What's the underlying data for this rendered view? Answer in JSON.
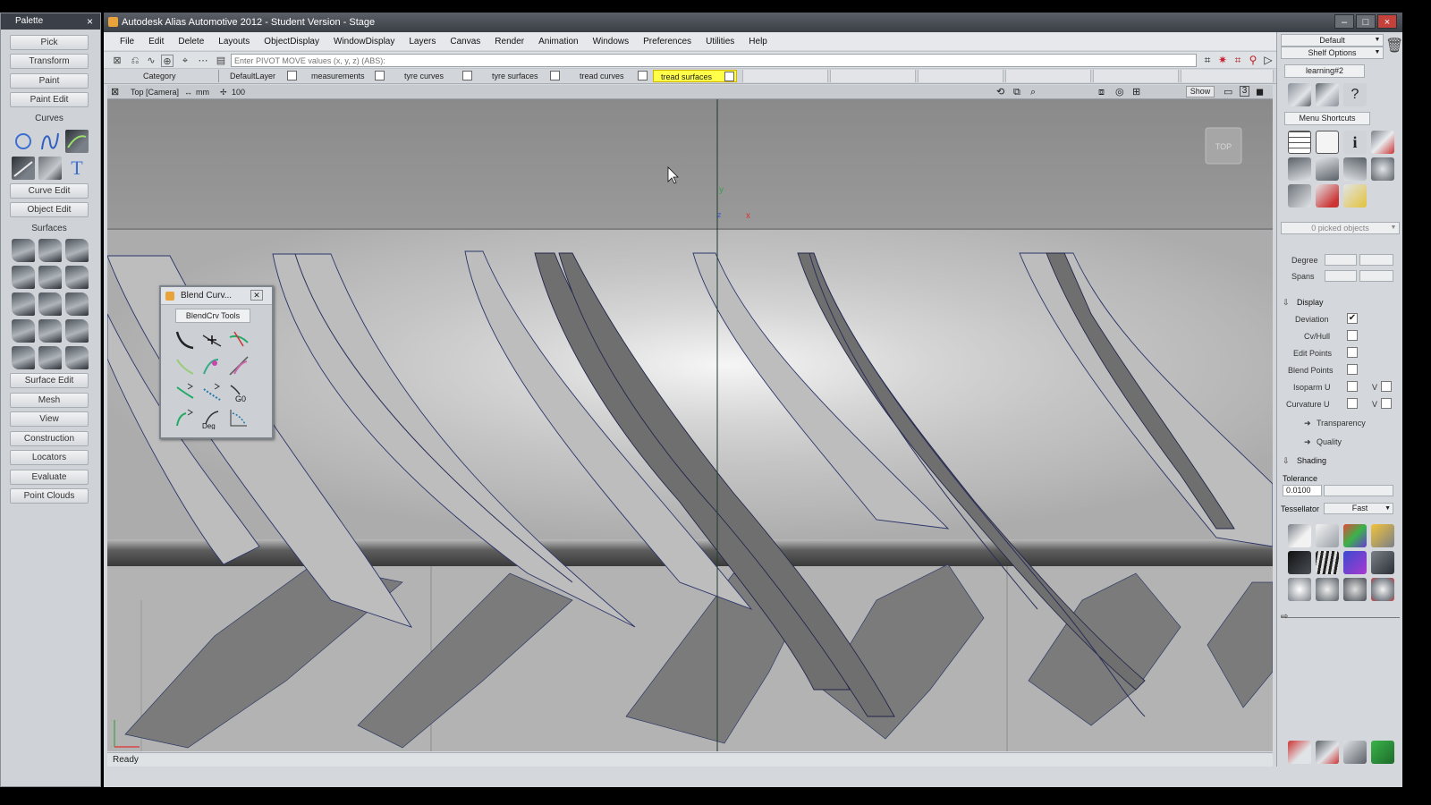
{
  "palette": {
    "title": "Palette",
    "buttons": {
      "pick": "Pick",
      "transform": "Transform",
      "paint": "Paint",
      "paint_edit": "Paint Edit",
      "curve_edit": "Curve Edit",
      "object_edit": "Object Edit",
      "surface_edit": "Surface Edit",
      "mesh": "Mesh",
      "view": "View",
      "construction": "Construction",
      "locators": "Locators",
      "evaluate": "Evaluate",
      "point_clouds": "Point Clouds"
    },
    "curves_header": "Curves",
    "surfaces_header": "Surfaces",
    "text_tool_glyph": "T"
  },
  "window": {
    "title": "Autodesk Alias Automotive 2012 - Student Version - Stage",
    "controls": [
      "–",
      "□",
      "×"
    ]
  },
  "menu": [
    "File",
    "Edit",
    "Delete",
    "Layouts",
    "ObjectDisplay",
    "WindowDisplay",
    "Layers",
    "Canvas",
    "Render",
    "Animation",
    "Windows",
    "Preferences",
    "Utilities",
    "Help"
  ],
  "prompt": {
    "placeholder": "Enter PIVOT MOVE values (x, y, z) (ABS):"
  },
  "layers": {
    "category": "Category",
    "items": [
      "DefaultLayer",
      "measurements",
      "tyre curves",
      "tyre surfaces",
      "tread curves",
      "tread surfaces"
    ],
    "active": "tread surfaces"
  },
  "viewport": {
    "camera": "Top [Camera]",
    "units": "mm",
    "grid_value": "100",
    "show_label": "Show",
    "view_cube_label": "TOP",
    "axis": {
      "x": "x",
      "y": "y",
      "z": "z"
    }
  },
  "status": "Ready",
  "right_panel": {
    "default_label": "Default",
    "shelf_options": "Shelf Options",
    "shelf_tab": "learning#2",
    "menu_shortcuts": "Menu Shortcuts",
    "picked_objects": "0 picked objects",
    "degree_label": "Degree",
    "spans_label": "Spans",
    "display_header": "Display",
    "deviation": "Deviation",
    "deviation_checked": true,
    "cvhull": "Cv/Hull",
    "edit_points": "Edit Points",
    "blend_points": "Blend Points",
    "isoparm_u": "Isoparm U",
    "curvature_u": "Curvature U",
    "v_label": "V",
    "transparency": "Transparency",
    "quality": "Quality",
    "shading": "Shading",
    "tolerance_label": "Tolerance",
    "tolerance_value": "0.0100",
    "tessellator_label": "Tessellator",
    "tessellator_value": "Fast"
  },
  "blend_window": {
    "title": "Blend Curv...",
    "tab": "BlendCrv Tools",
    "g0_label": "G0",
    "deg_label": "Deg"
  }
}
